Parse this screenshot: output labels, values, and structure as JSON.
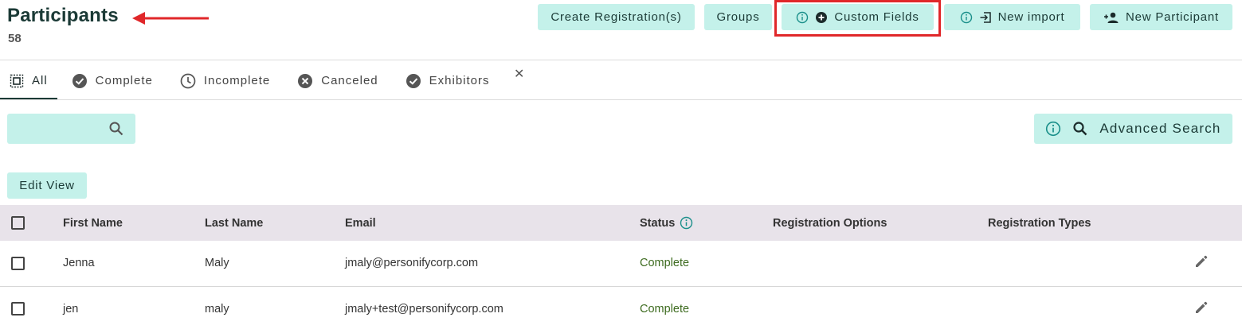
{
  "header": {
    "title": "Participants",
    "count": "58"
  },
  "toolbar": {
    "create_label": "Create Registration(s)",
    "groups_label": "Groups",
    "custom_label": "Custom Fields",
    "import_label": "New import",
    "new_label": "New Participant"
  },
  "tabs": [
    {
      "label": "All",
      "icon": "select-all-icon"
    },
    {
      "label": "Complete",
      "icon": "check-circle-icon"
    },
    {
      "label": "Incomplete",
      "icon": "clock-icon"
    },
    {
      "label": "Canceled",
      "icon": "x-circle-icon"
    },
    {
      "label": "Exhibitors",
      "icon": "check-circle-icon"
    }
  ],
  "search": {
    "placeholder": "",
    "advanced_label": "Advanced Search"
  },
  "edit_view_label": "Edit View",
  "table": {
    "columns": [
      "First Name",
      "Last Name",
      "Email",
      "Status",
      "Registration Options",
      "Registration Types"
    ],
    "rows": [
      {
        "first": "Jenna",
        "last": "Maly",
        "email": "jmaly@personifycorp.com",
        "status": "Complete"
      },
      {
        "first": "jen",
        "last": "maly",
        "email": "jmaly+test@personifycorp.com",
        "status": "Complete"
      }
    ]
  },
  "colors": {
    "button_bg": "#c4f1ea",
    "header_row_bg": "#e8e3ea",
    "status_complete": "#3d6b1f",
    "annotation_red": "#e0272a",
    "info_icon": "#1a8f8a"
  }
}
